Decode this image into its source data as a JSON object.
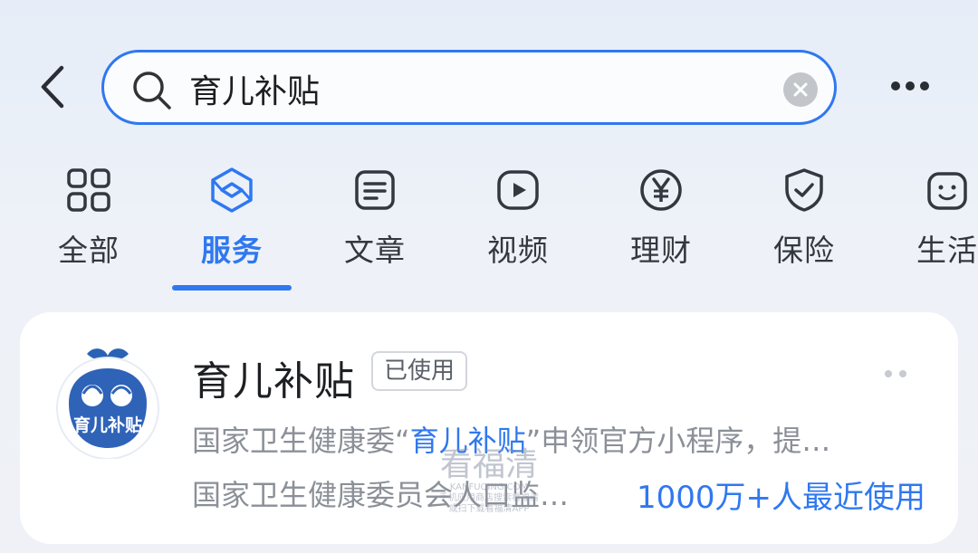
{
  "search": {
    "value": "育儿补贴"
  },
  "tabs": [
    {
      "label": "全部",
      "icon": "grid-icon"
    },
    {
      "label": "服务",
      "icon": "service-cube-icon",
      "active": true
    },
    {
      "label": "文章",
      "icon": "article-icon"
    },
    {
      "label": "视频",
      "icon": "video-play-icon"
    },
    {
      "label": "理财",
      "icon": "yen-icon"
    },
    {
      "label": "保险",
      "icon": "shield-check-icon"
    },
    {
      "label": "生活",
      "icon": "life-icon"
    }
  ],
  "result": {
    "title": "育儿补贴",
    "badge": "已使用",
    "logo_text": "育儿补贴",
    "desc_pre": "国家卫生健康委“",
    "desc_highlight": "育儿补贴",
    "desc_post": "”申领官方小程序，提…",
    "desc_line2": "国家卫生健康委员会人口监…",
    "users": "1000万+人最近使用"
  },
  "watermark": {
    "title": "看福清",
    "line1": "KANFUQING.COM",
    "line2": "手机应用商店搜索看福清",
    "line3": "或扫下载看福清APP"
  },
  "colors": {
    "accent": "#2f78f0",
    "muted": "#8b9098"
  }
}
